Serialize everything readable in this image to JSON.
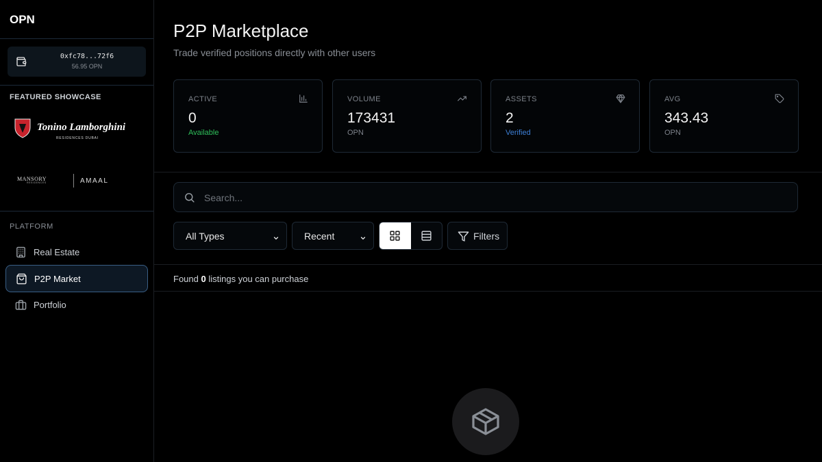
{
  "app": {
    "brand": "OPN"
  },
  "wallet": {
    "address": "0xfc78...72f6",
    "balance": "56.95 OPN"
  },
  "sidebar": {
    "featured_title": "FEATURED SHOWCASE",
    "showcase": [
      {
        "name": "Tonino Lamborghini",
        "sub": "RESIDENCES DUBAI"
      },
      {
        "name": "MANSORY",
        "sub": "RESIDENCES",
        "partner": "AMAAL"
      }
    ],
    "platform_title": "PLATFORM",
    "nav": [
      {
        "label": "Real Estate",
        "icon": "building-icon"
      },
      {
        "label": "P2P Market",
        "icon": "shopping-bag-icon",
        "active": true
      },
      {
        "label": "Portfolio",
        "icon": "briefcase-icon"
      }
    ]
  },
  "header": {
    "title": "P2P Marketplace",
    "subtitle": "Trade verified positions directly with other users"
  },
  "stats": [
    {
      "label": "ACTIVE",
      "value": "0",
      "sub": "Available",
      "icon": "bar-chart-icon",
      "sub_color": "#2fbf5a"
    },
    {
      "label": "VOLUME",
      "value": "173431",
      "sub": "OPN",
      "icon": "trending-up-icon"
    },
    {
      "label": "ASSETS",
      "value": "2",
      "sub": "Verified",
      "icon": "diamond-icon",
      "sub_color": "#3d7fd6"
    },
    {
      "label": "AVG",
      "value": "343.43",
      "sub": "OPN",
      "icon": "tag-icon"
    }
  ],
  "search": {
    "placeholder": "Search..."
  },
  "filters": {
    "type_select": "All Types",
    "sort_select": "Recent",
    "view_mode": "grid",
    "filters_label": "Filters"
  },
  "results": {
    "prefix": "Found",
    "count": "0",
    "suffix": "listings you can purchase"
  },
  "empty_state": {
    "icon": "package-icon"
  },
  "colors": {
    "accent_green": "#2fbf5a",
    "accent_blue": "#3d7fd6",
    "active_border": "#3a5f86"
  }
}
